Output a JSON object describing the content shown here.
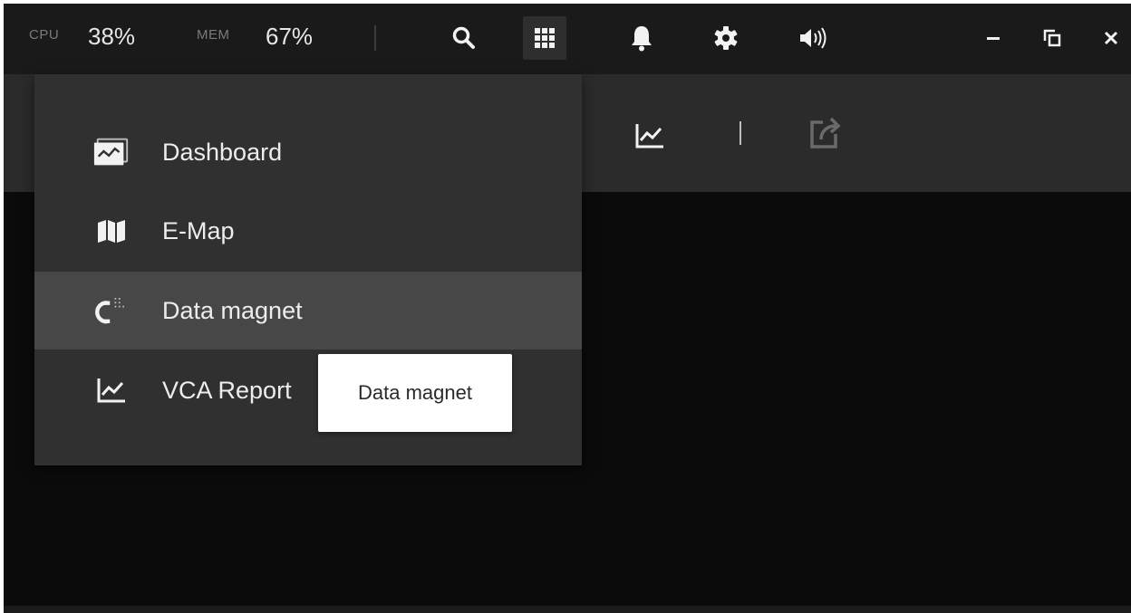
{
  "topbar": {
    "cpu_label": "CPU",
    "cpu_value": "38%",
    "mem_label": "MEM",
    "mem_value": "67%",
    "icons": [
      "search-icon",
      "apps-grid-icon",
      "bell-icon",
      "gear-icon",
      "speaker-icon",
      "minimize-icon",
      "restore-icon",
      "close-icon"
    ]
  },
  "toolbar": {
    "icons": [
      "vca-report-icon",
      "export-icon"
    ]
  },
  "menu": {
    "items": [
      {
        "label": "Dashboard",
        "icon": "dashboard-icon"
      },
      {
        "label": "E-Map",
        "icon": "map-icon"
      },
      {
        "label": "Data magnet",
        "icon": "magnet-icon",
        "highlighted": true
      },
      {
        "label": "VCA Report",
        "icon": "chart-icon"
      }
    ]
  },
  "tooltip": {
    "text": "Data magnet"
  },
  "colors": {
    "app_background": "#0b0b0b",
    "topbar": "#1a1a1a",
    "toolbar": "#2b2b2b",
    "menu": "#303030",
    "menu_highlight": "#474747",
    "tooltip": "#ffffff"
  }
}
